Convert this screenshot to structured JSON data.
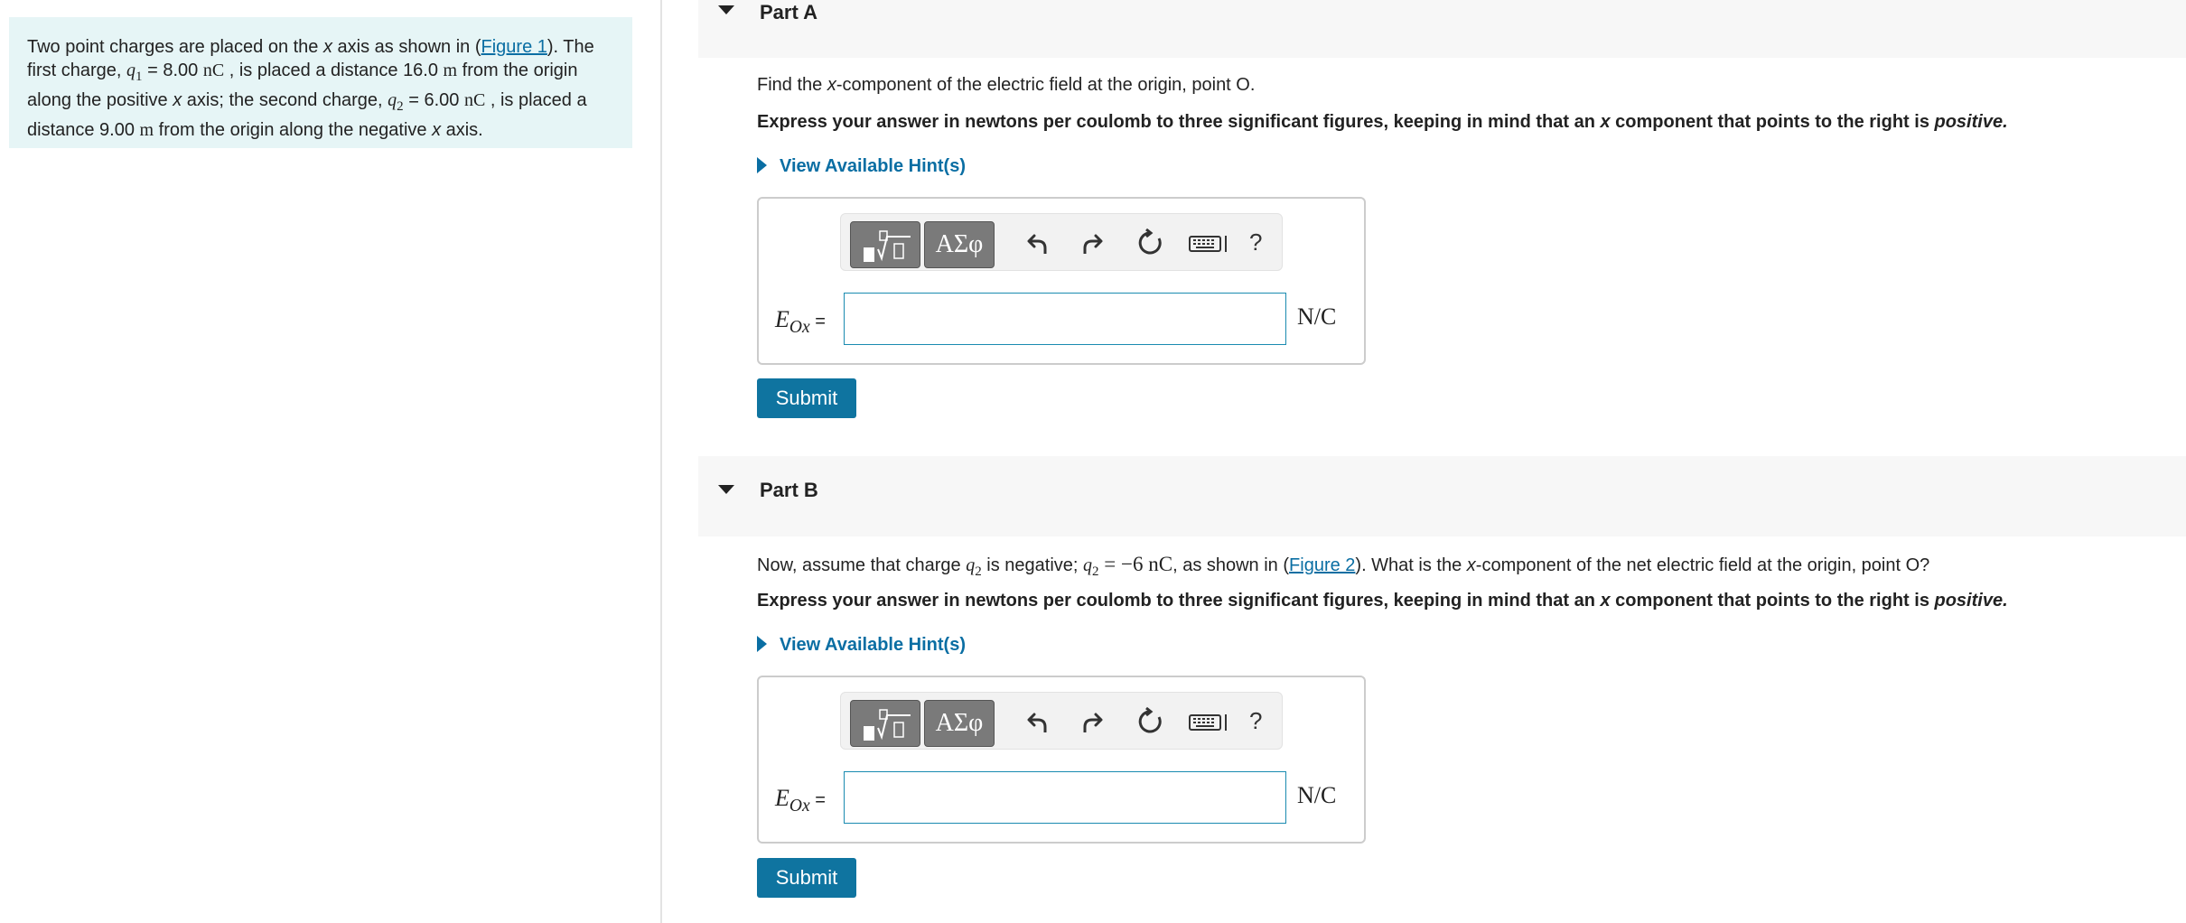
{
  "problem": {
    "t1": "Two point charges are placed on the ",
    "x1": "x",
    "t2": " axis as shown in (",
    "fig": "Figure 1",
    "t3": "). The first charge, ",
    "q1": "q",
    "q1sub": "1",
    "t4": " = 8.00 ",
    "nC1": "nC",
    "t5": " , is placed a distance 16.0 ",
    "m1": "m",
    "t6": " from the origin along the positive ",
    "x2": "x",
    "t7": " axis; the second charge, ",
    "q2": "q",
    "q2sub": "2",
    "t8": " = 6.00 ",
    "nC2": "nC",
    "t9": " , is placed a distance 9.00 ",
    "m2": "m",
    "t10": " from the origin along the negative ",
    "x3": "x",
    "t11": " axis."
  },
  "partA": {
    "title": "Part A",
    "q_pre": "Find the ",
    "q_x": "x",
    "q_post": "-component of the electric field at the origin, point O.",
    "instr_pre": "Express your answer in newtons per coulomb to three significant figures, keeping in mind that an ",
    "instr_x": "x",
    "instr_mid": " component that points to the right is ",
    "instr_pos": "positive.",
    "hint": "View Available Hint(s)",
    "label_E": "E",
    "label_sub": "Ox",
    "label_eq": " =",
    "value": "",
    "unit": "N/C",
    "submit": "Submit"
  },
  "partB": {
    "title": "Part B",
    "q1": "Now, assume that charge ",
    "q_q": "q",
    "q_sub": "2",
    "q2": " is negative; ",
    "q_q2": "q",
    "q_sub2": "2",
    "q_val": " = −6 nC",
    "q3": ", as shown in (",
    "fig": "Figure 2",
    "q4": "). What is the ",
    "q_x": "x",
    "q5": "-component of the net electric field at the origin, point O?",
    "instr_pre": "Express your answer in newtons per coulomb to three significant figures, keeping in mind that an ",
    "instr_x": "x",
    "instr_mid": " component that points to the right is ",
    "instr_pos": "positive.",
    "hint": "View Available Hint(s)",
    "label_E": "E",
    "label_sub": "Ox",
    "label_eq": " =",
    "value": "",
    "unit": "N/C",
    "submit": "Submit"
  },
  "toolbar": {
    "symbols_label": "ΑΣφ",
    "help_label": "?"
  },
  "colors": {
    "accent": "#0f74a0",
    "link": "#0a6ea3",
    "problem_bg": "#e6f5f6",
    "part_bg": "#f7f7f7"
  }
}
